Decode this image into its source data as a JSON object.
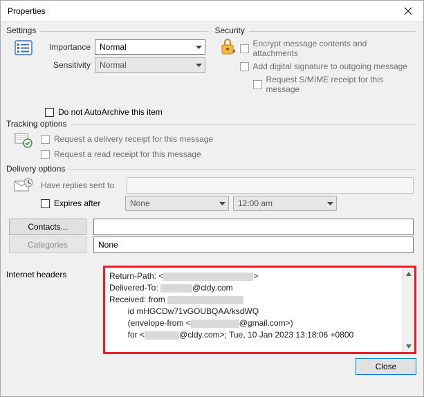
{
  "window": {
    "title": "Properties"
  },
  "settings": {
    "legend": "Settings",
    "importance_label": "Importance",
    "importance_value": "Normal",
    "sensitivity_label": "Sensitivity",
    "sensitivity_value": "Normal",
    "autoarchive_label": "Do not AutoArchive this item"
  },
  "security": {
    "legend": "Security",
    "encrypt_label": "Encrypt message contents and attachments",
    "signature_label": "Add digital signature to outgoing message",
    "smime_label": "Request S/MIME receipt for this message"
  },
  "tracking": {
    "legend": "Tracking options",
    "delivery_receipt_label": "Request a delivery receipt for this message",
    "read_receipt_label": "Request a read receipt for this message"
  },
  "delivery": {
    "legend": "Delivery options",
    "replies_label": "Have replies sent to",
    "replies_value": "",
    "expires_label": "Expires after",
    "expires_date": "None",
    "expires_time": "12:00 am",
    "contacts_btn": "Contacts...",
    "contacts_value": "",
    "categories_btn": "Categories",
    "categories_value": "None"
  },
  "headers": {
    "label": "Internet headers",
    "line1_a": "Return-Path: <",
    "line1_b": ">",
    "line2_a": "Delivered-To: ",
    "line2_b": "@cldy.com",
    "line3_a": "Received: from ",
    "line4": "        id mHGCDw71vGOUBQAA/ksdWQ",
    "line5_a": "        (envelope-from <",
    "line5_b": "@gmail.com>)",
    "line6_a": "        for <",
    "line6_b": "@cldy.com>; Tue, 10 Jan 2023 13:18:06 +0800"
  },
  "footer": {
    "close_btn": "Close"
  }
}
